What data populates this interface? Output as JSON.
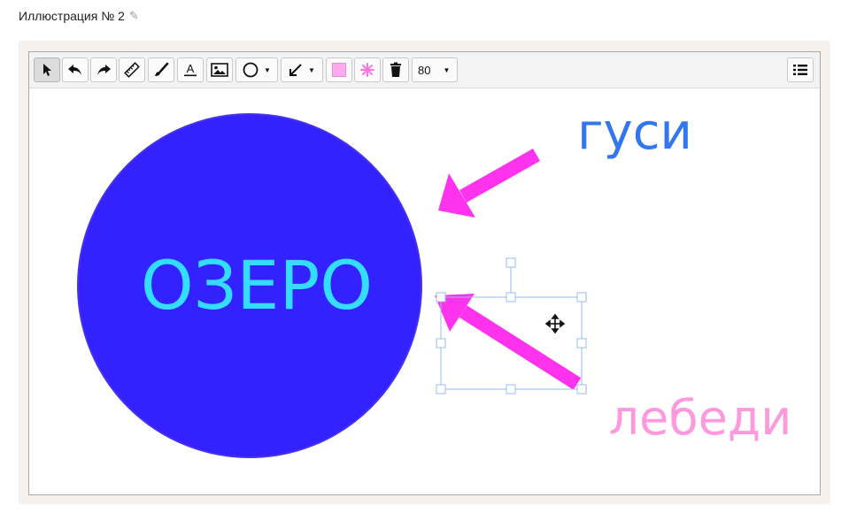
{
  "header": {
    "title": "Иллюстрация № 2",
    "edit_icon": "pencil-icon"
  },
  "toolbar": {
    "buttons": [
      {
        "name": "select",
        "icon": "cursor-arrow-icon",
        "active": true
      },
      {
        "name": "undo",
        "icon": "undo-icon"
      },
      {
        "name": "redo",
        "icon": "redo-icon"
      },
      {
        "name": "ruler",
        "icon": "ruler-icon"
      },
      {
        "name": "brush",
        "icon": "brush-icon"
      },
      {
        "name": "text",
        "icon": "text-tool-icon",
        "glyph": "A"
      },
      {
        "name": "image",
        "icon": "image-icon"
      },
      {
        "name": "shape",
        "icon": "circle-icon",
        "dropdown": true
      },
      {
        "name": "arrow",
        "icon": "arrow-icon",
        "dropdown": true
      },
      {
        "name": "fill-color",
        "icon": "color-swatch",
        "color": "#ffaaee"
      },
      {
        "name": "stroke-color",
        "icon": "star-burst-icon",
        "color": "#ff77dd"
      },
      {
        "name": "delete",
        "icon": "trash-icon"
      }
    ],
    "size_value": "80",
    "menu_icon": "list-menu-icon"
  },
  "canvas": {
    "lake_label": "ОЗЕРО",
    "geese_label": "гуси",
    "swans_label": "лебеди",
    "colors": {
      "lake_fill": "#3322ff",
      "lake_text": "#33ddff",
      "arrow": "#ff33ee",
      "geese_text": "#3377ee",
      "swans_text": "#ff99dd",
      "selection": "#99bbee"
    }
  }
}
